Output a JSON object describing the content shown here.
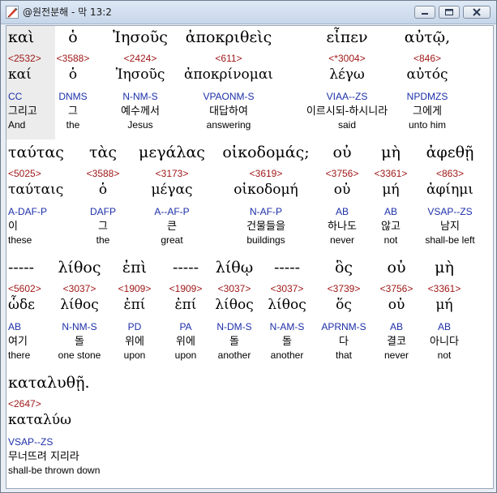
{
  "window": {
    "title": "@원전분해 - 막 13:2"
  },
  "rows": [
    {
      "words": [
        {
          "greek": "καὶ",
          "strong": "<2532>",
          "lemma": "καί",
          "parse": "CC",
          "korean": "그리고",
          "english": "And"
        },
        {
          "greek": "ὁ",
          "strong": "<3588>",
          "lemma": "ὁ",
          "parse": "DNMS",
          "korean": "그",
          "english": "the"
        },
        {
          "greek": "Ἰησοῦς",
          "strong": "<2424>",
          "lemma": "Ἰησοῦς",
          "parse": "N-NM-S",
          "korean": "예수께서",
          "english": "Jesus"
        },
        {
          "greek": "ἀποκριθεὶς",
          "strong": "<611>",
          "lemma": "ἀποκρίνομαι",
          "parse": "VPAONM-S",
          "korean": "대답하여",
          "english": "answering"
        },
        {
          "greek": "εἶπεν",
          "strong": "<*3004>",
          "lemma": "λέγω",
          "parse": "VIAA--ZS",
          "korean": "이르시되-하시니라",
          "english": "said"
        },
        {
          "greek": "αὐτῷ,",
          "strong": "<846>",
          "lemma": "αὐτός",
          "parse": "NPDMZS",
          "korean": "그에게",
          "english": "unto him"
        }
      ]
    },
    {
      "words": [
        {
          "greek": "ταύτας",
          "strong": "<5025>",
          "lemma": "ταύταις",
          "parse": "A-DAF-P",
          "korean": "이",
          "english": "these"
        },
        {
          "greek": "τὰς",
          "strong": "<3588>",
          "lemma": "ὁ",
          "parse": "DAFP",
          "korean": "그",
          "english": "the"
        },
        {
          "greek": "μεγάλας",
          "strong": "<3173>",
          "lemma": "μέγας",
          "parse": "A--AF-P",
          "korean": "큰",
          "english": "great"
        },
        {
          "greek": "οἰκοδομάς;",
          "strong": "<3619>",
          "lemma": "οἰκοδομή",
          "parse": "N-AF-P",
          "korean": "건물들을",
          "english": "buildings"
        },
        {
          "greek": "οὐ",
          "strong": "<3756>",
          "lemma": "οὐ",
          "parse": "AB",
          "korean": "하나도",
          "english": "never"
        },
        {
          "greek": "μὴ",
          "strong": "<3361>",
          "lemma": "μή",
          "parse": "AB",
          "korean": "않고",
          "english": "not"
        },
        {
          "greek": "ἀφεθῇ",
          "strong": "<863>",
          "lemma": "ἀφίημι",
          "parse": "VSAP--ZS",
          "korean": "남지",
          "english": "shall-be left"
        }
      ]
    },
    {
      "words": [
        {
          "greek": "-----",
          "strong": "<5602>",
          "lemma": "ὧδε",
          "parse": "AB",
          "korean": "여기",
          "english": "there"
        },
        {
          "greek": "λίθος",
          "strong": "<3037>",
          "lemma": "λίθος",
          "parse": "N-NM-S",
          "korean": "돌",
          "english": "one stone"
        },
        {
          "greek": "ἐπὶ",
          "strong": "<1909>",
          "lemma": "ἐπί",
          "parse": "PD",
          "korean": "위에",
          "english": "upon"
        },
        {
          "greek": "-----",
          "strong": "<1909>",
          "lemma": "ἐπί",
          "parse": "PA",
          "korean": "위에",
          "english": "upon"
        },
        {
          "greek": "λίθῳ",
          "strong": "<3037>",
          "lemma": "λίθος",
          "parse": "N-DM-S",
          "korean": "돌",
          "english": "another"
        },
        {
          "greek": "-----",
          "strong": "<3037>",
          "lemma": "λίθος",
          "parse": "N-AM-S",
          "korean": "돌",
          "english": "another"
        },
        {
          "greek": "ὃς",
          "strong": "<3739>",
          "lemma": "ὅς",
          "parse": "APRNM-S",
          "korean": "다",
          "english": "that"
        },
        {
          "greek": "οὐ",
          "strong": "<3756>",
          "lemma": "οὐ",
          "parse": "AB",
          "korean": "결코",
          "english": "never"
        },
        {
          "greek": "μὴ",
          "strong": "<3361>",
          "lemma": "μή",
          "parse": "AB",
          "korean": "아니다",
          "english": "not"
        }
      ]
    },
    {
      "words": [
        {
          "greek": "καταλυθῇ.",
          "strong": "<2647>",
          "lemma": "καταλύω",
          "parse": "VSAP--ZS",
          "korean": "무너뜨려 지리라",
          "english": "shall-be thrown down"
        }
      ]
    }
  ]
}
